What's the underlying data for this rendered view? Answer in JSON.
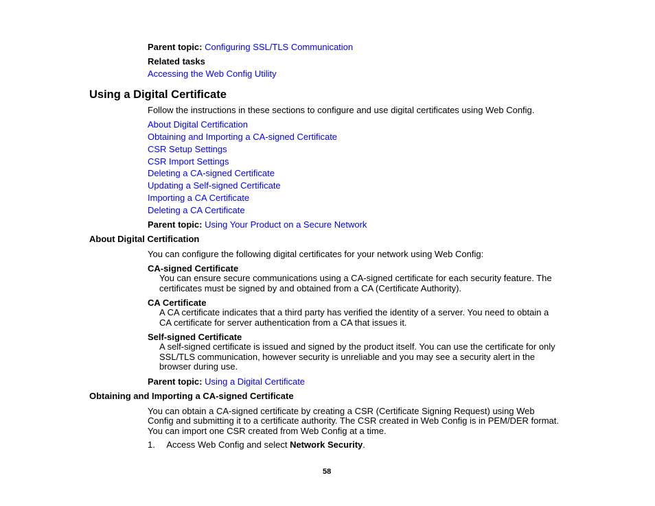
{
  "top": {
    "parent_label": "Parent topic:",
    "parent_link": "Configuring SSL/TLS Communication",
    "related_heading": "Related tasks",
    "related_link": "Accessing the Web Config Utility"
  },
  "section": {
    "title": "Using a Digital Certificate",
    "intro": "Follow the instructions in these sections to configure and use digital certificates using Web Config.",
    "links": [
      "About Digital Certification",
      "Obtaining and Importing a CA-signed Certificate",
      "CSR Setup Settings",
      "CSR Import Settings",
      "Deleting a CA-signed Certificate",
      "Updating a Self-signed Certificate",
      "Importing a CA Certificate",
      "Deleting a CA Certificate"
    ],
    "parent_label": "Parent topic:",
    "parent_link": "Using Your Product on a Secure Network"
  },
  "about": {
    "title": "About Digital Certification",
    "intro": "You can configure the following digital certificates for your network using Web Config:",
    "items": [
      {
        "term": "CA-signed Certificate",
        "lines": [
          "You can ensure secure communications using a CA-signed certificate for each security feature. The",
          "certificates must be signed by and obtained from a CA (Certificate Authority)."
        ]
      },
      {
        "term": "CA Certificate",
        "lines": [
          "A CA certificate indicates that a third party has verified the identity of a server. You need to obtain a",
          "CA certificate for server authentication from a CA that issues it."
        ]
      },
      {
        "term": "Self-signed Certificate",
        "lines": [
          "A self-signed certificate is issued and signed by the product itself. You can use the certificate for only",
          "SSL/TLS communication, however security is unreliable and you may see a security alert in the",
          "browser during use."
        ]
      }
    ],
    "parent_label": "Parent topic:",
    "parent_link": "Using a Digital Certificate"
  },
  "obtaining": {
    "title": "Obtaining and Importing a CA-signed Certificate",
    "lines": [
      "You can obtain a CA-signed certificate by creating a CSR (Certificate Signing Request) using Web",
      "Config and submitting it to a certificate authority. The CSR created in Web Config is in PEM/DER format.",
      "You can import one CSR created from Web Config at a time."
    ],
    "step_number": "1.",
    "step_text_before": "Access Web Config and select ",
    "step_text_bold": "Network Security",
    "step_text_after": "."
  },
  "footer": {
    "page_number": "58"
  },
  "colors": {
    "link": "#0000ff",
    "text": "#000000",
    "background": "#ffffff"
  }
}
